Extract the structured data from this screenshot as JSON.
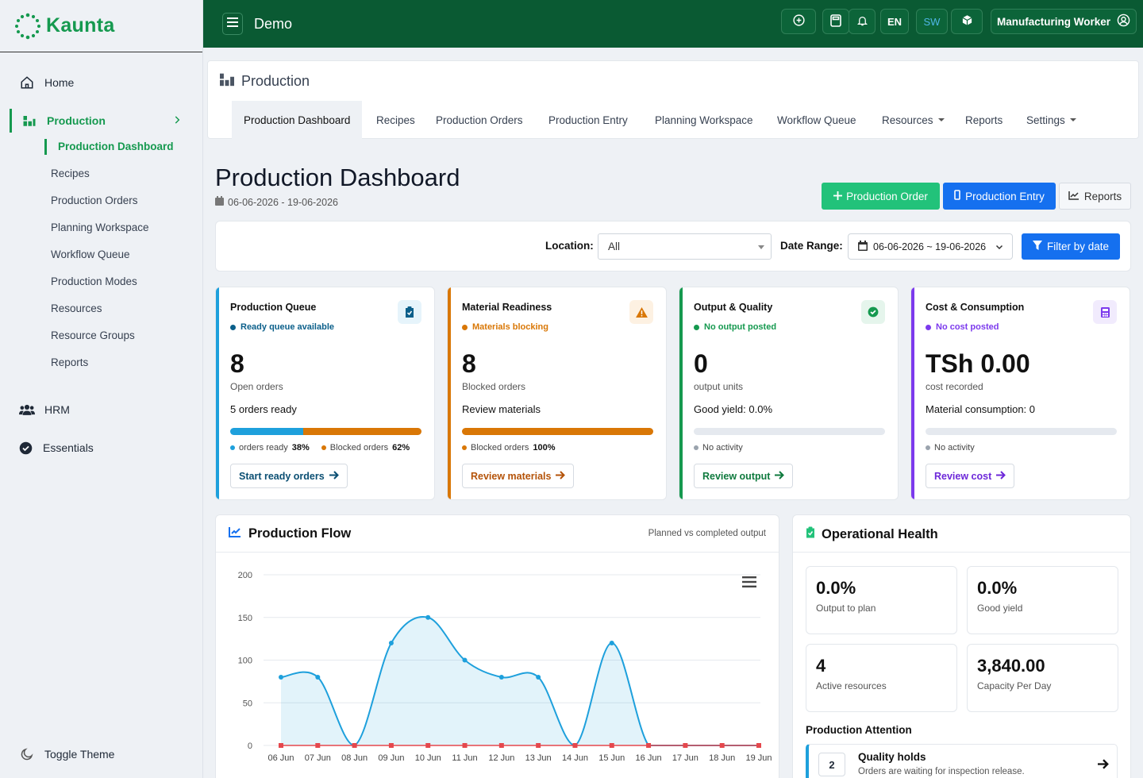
{
  "brand": {
    "name": "Kaunta",
    "color": "#15994f"
  },
  "sidebar": {
    "items": [
      {
        "label": "Home",
        "icon": "home-icon"
      },
      {
        "label": "Production",
        "icon": "factory-icon"
      },
      {
        "label": "HRM",
        "icon": "users-icon"
      },
      {
        "label": "Essentials",
        "icon": "check-circle-icon"
      }
    ],
    "production_sub": [
      "Production Dashboard",
      "Recipes",
      "Production Orders",
      "Planning Workspace",
      "Workflow Queue",
      "Production Modes",
      "Resources",
      "Resource Groups",
      "Reports"
    ],
    "toggle_theme": "Toggle Theme"
  },
  "topbar": {
    "business": "Demo",
    "lang_en": "EN",
    "lang_sw": "SW",
    "user": "Manufacturing Worker"
  },
  "module": {
    "title": "Production",
    "tabs": [
      "Production Dashboard",
      "Recipes",
      "Production Orders",
      "Production Entry",
      "Planning Workspace",
      "Workflow Queue",
      "Resources",
      "Reports",
      "Settings"
    ]
  },
  "page": {
    "title": "Production Dashboard",
    "date_range": "06-06-2026 - 19-06-2026",
    "btn_order": "Production Order",
    "btn_entry": "Production Entry",
    "btn_reports": "Reports"
  },
  "filters": {
    "location_label": "Location:",
    "location_value": "All",
    "date_label": "Date Range:",
    "date_value": "06-06-2026 ~ 19-06-2026",
    "filter_btn": "Filter by date"
  },
  "cards": [
    {
      "title": "Production Queue",
      "status": "Ready queue available",
      "value": "8",
      "label": "Open orders",
      "detail": "5 orders ready",
      "legend": [
        {
          "text": "orders ready",
          "pct": "38%",
          "frac": 0.38,
          "color": "#1ea0dc"
        },
        {
          "text": "Blocked orders",
          "pct": "62%",
          "frac": 0.62,
          "color": "#d97706"
        }
      ],
      "button": "Start ready orders",
      "accent": "#1ea0dc",
      "status_color": "#0b5f8a"
    },
    {
      "title": "Material Readiness",
      "status": "Materials blocking",
      "value": "8",
      "label": "Blocked orders",
      "detail": "Review materials",
      "legend": [
        {
          "text": "Blocked orders",
          "pct": "100%",
          "frac": 1.0,
          "color": "#d97706"
        }
      ],
      "button": "Review materials",
      "accent": "#d97706",
      "status_color": "#d97706"
    },
    {
      "title": "Output & Quality",
      "status": "No output posted",
      "value": "0",
      "label": "output units",
      "detail": "Good yield: 0.0%",
      "legend": [
        {
          "text": "No activity",
          "pct": "",
          "frac": 0,
          "color": "#9aa3ad"
        }
      ],
      "button": "Review output",
      "accent": "#15994f",
      "status_color": "#15994f"
    },
    {
      "title": "Cost & Consumption",
      "status": "No cost posted",
      "value": "TSh 0.00",
      "label": "cost recorded",
      "detail": "Material consumption: 0",
      "legend": [
        {
          "text": "No activity",
          "pct": "",
          "frac": 0,
          "color": "#9aa3ad"
        }
      ],
      "button": "Review cost",
      "accent": "#7c3aed",
      "status_color": "#7c3aed"
    }
  ],
  "flow": {
    "title": "Production Flow",
    "subtitle": "Planned vs completed output"
  },
  "chart_data": {
    "type": "line",
    "categories": [
      "06 Jun",
      "07 Jun",
      "08 Jun",
      "09 Jun",
      "10 Jun",
      "11 Jun",
      "12 Jun",
      "13 Jun",
      "14 Jun",
      "15 Jun",
      "16 Jun",
      "17 Jun",
      "18 Jun",
      "19 Jun"
    ],
    "series": [
      {
        "values": [
          80,
          80,
          0,
          120,
          150,
          100,
          80,
          80,
          0,
          120,
          0,
          0,
          0,
          0
        ],
        "color": "#1ea0dc"
      },
      {
        "values": [
          0,
          0,
          0,
          0,
          0,
          0,
          0,
          0,
          0,
          0,
          0,
          0,
          0,
          0
        ],
        "color": "#e5484d"
      }
    ],
    "ylim": [
      0,
      200
    ],
    "yticks": [
      0,
      50,
      100,
      150,
      200
    ]
  },
  "health": {
    "title": "Operational Health",
    "metrics": [
      {
        "value": "0.0%",
        "label": "Output to plan"
      },
      {
        "value": "0.0%",
        "label": "Good yield"
      },
      {
        "value": "4",
        "label": "Active resources"
      },
      {
        "value": "3,840.00",
        "label": "Capacity Per Day"
      }
    ],
    "attention_title": "Production Attention",
    "attention": {
      "count": "2",
      "title": "Quality holds",
      "desc": "Orders are waiting for inspection release."
    }
  }
}
